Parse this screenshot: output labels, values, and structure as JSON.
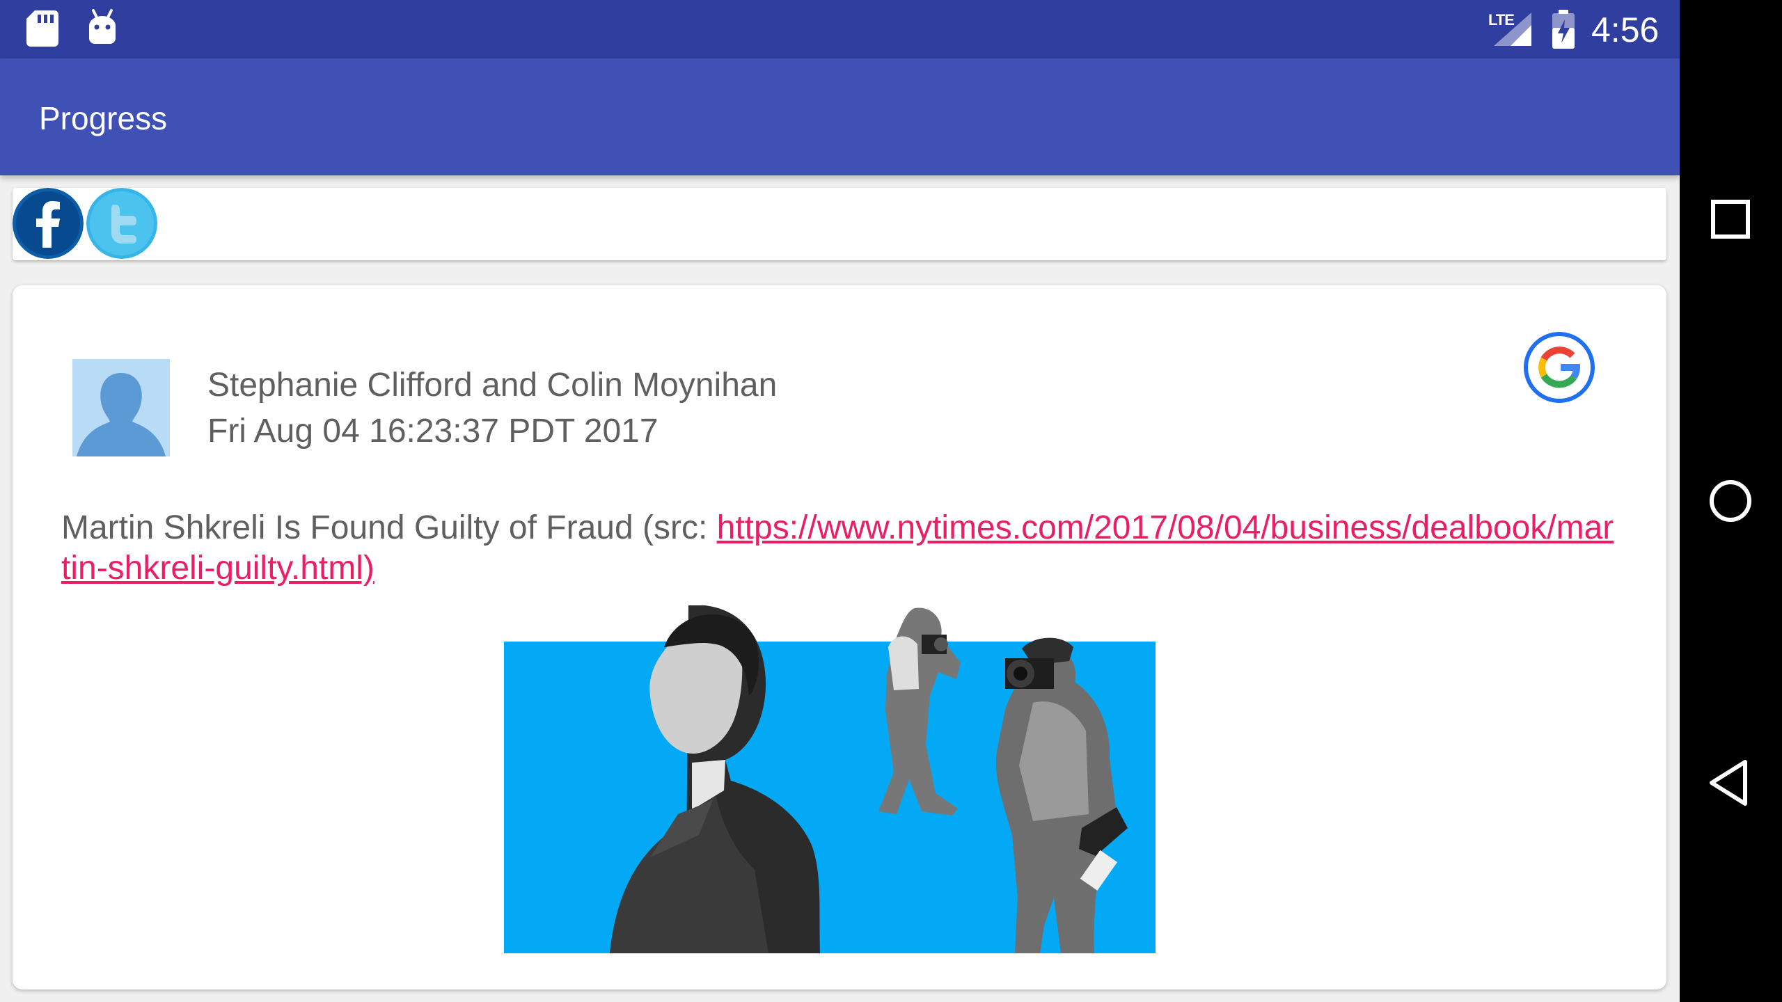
{
  "status_bar": {
    "network_type": "LTE",
    "time": "4:56"
  },
  "app_bar": {
    "title": "Progress"
  },
  "share": {
    "icons": [
      "facebook-icon",
      "twitter-icon"
    ]
  },
  "post": {
    "author": "Stephanie Clifford and Colin Moynihan",
    "date": "Fri Aug 04 16:23:37 PDT 2017",
    "text_prefix": "Martin Shkreli Is Found Guilty of Fraud (src: ",
    "link": "https://www.nytimes.com/2017/08/04/business/dealbook/martin-shkreli-guilty.html)",
    "source_icon": "google-icon"
  },
  "colors": {
    "status_bar": "#303f9f",
    "app_bar": "#3f51b5",
    "link": "#e91e63",
    "image_background": "#03a9f4"
  }
}
